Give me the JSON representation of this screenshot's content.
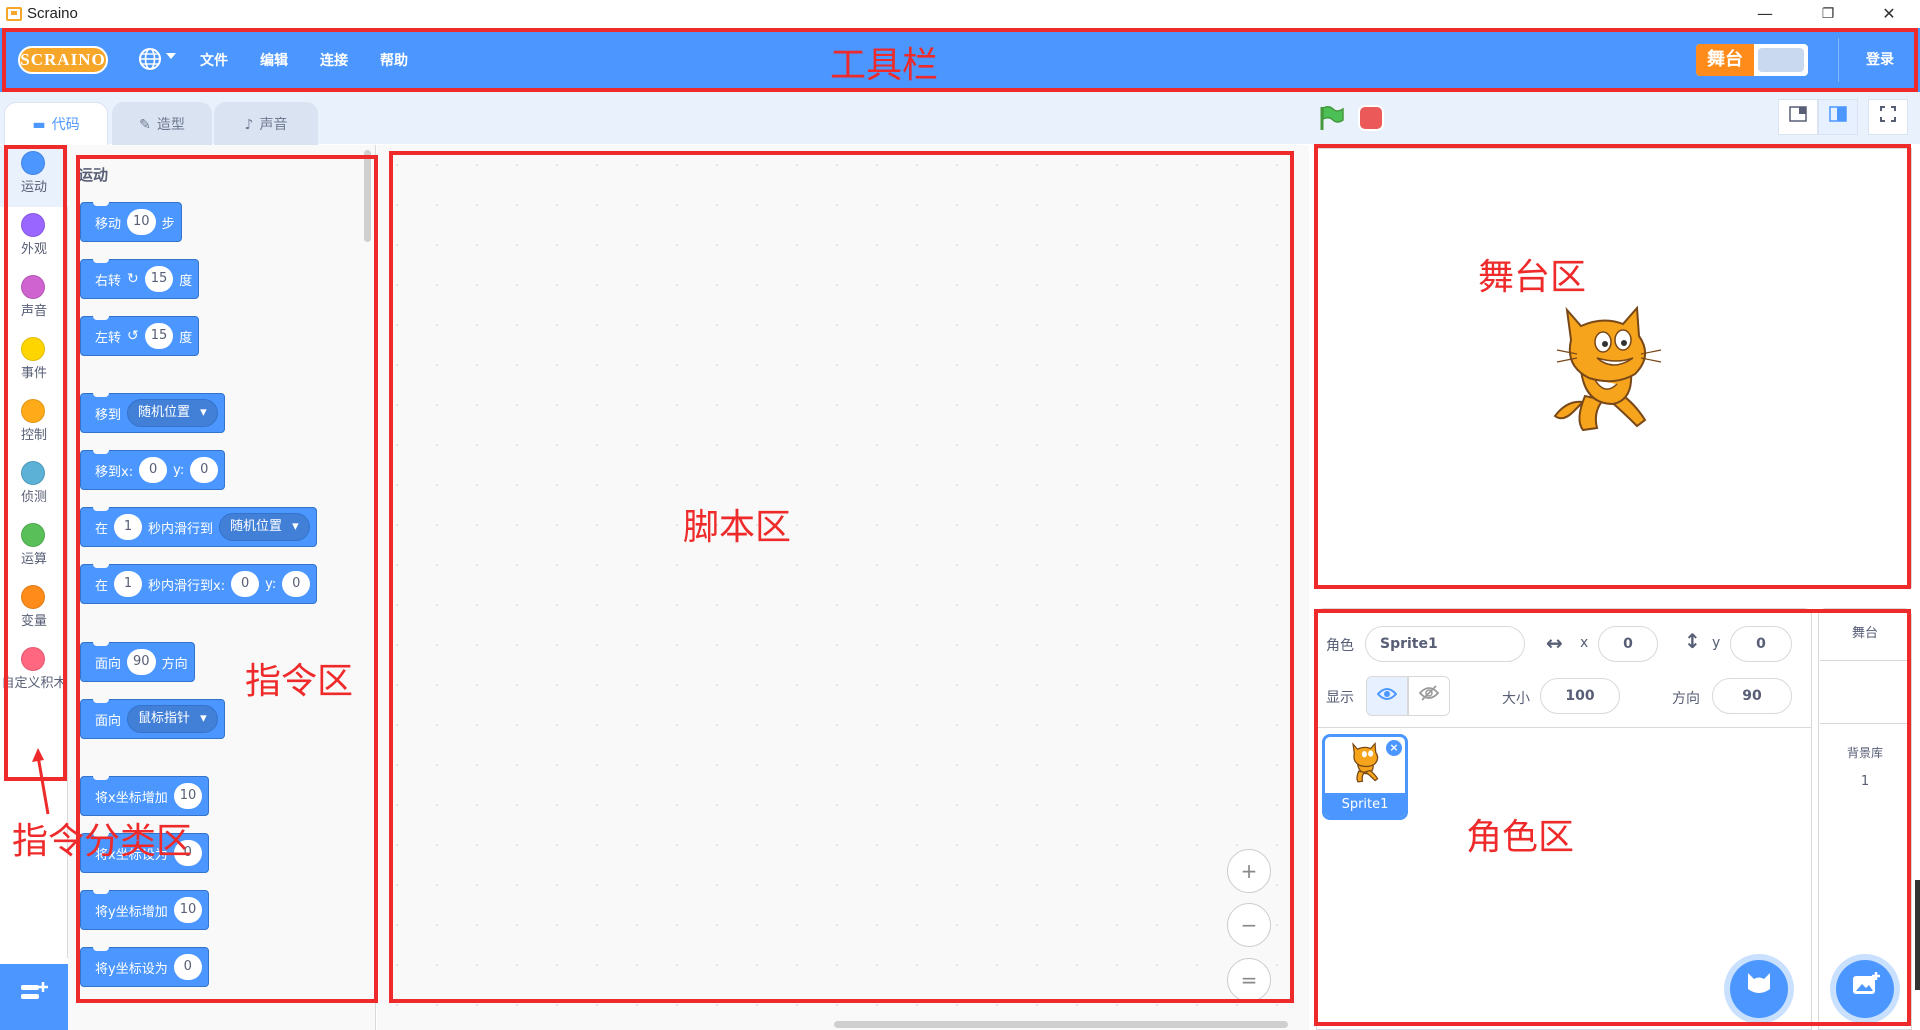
{
  "window": {
    "title": "Scraino",
    "minimize": "—",
    "maximize": "❐",
    "close": "✕"
  },
  "menubar": {
    "logo": "SCRAINO",
    "items": [
      "文件",
      "编辑",
      "连接",
      "帮助"
    ],
    "stage_toggle": "舞台",
    "login": "登录",
    "color": "#4c97ff"
  },
  "tabs": [
    {
      "label": "代码",
      "icon": "code-icon"
    },
    {
      "label": "造型",
      "icon": "brush-icon"
    },
    {
      "label": "声音",
      "icon": "speaker-icon"
    }
  ],
  "categories": [
    {
      "label": "运动",
      "color": "#4c97ff"
    },
    {
      "label": "外观",
      "color": "#9966ff"
    },
    {
      "label": "声音",
      "color": "#cf63cf"
    },
    {
      "label": "事件",
      "color": "#ffd500"
    },
    {
      "label": "控制",
      "color": "#ffab19"
    },
    {
      "label": "侦测",
      "color": "#5cb1d6"
    },
    {
      "label": "运算",
      "color": "#59c059"
    },
    {
      "label": "变量",
      "color": "#ff8c1a"
    },
    {
      "label": "自定义积木",
      "color": "#ff6680"
    }
  ],
  "palette": {
    "heading": "运动",
    "blocks": {
      "move": {
        "label": "移动",
        "value": "10",
        "suffix": "步"
      },
      "turn_right": {
        "label": "右转",
        "value": "15",
        "suffix": "度"
      },
      "turn_left": {
        "label": "左转",
        "value": "15",
        "suffix": "度"
      },
      "goto": {
        "label": "移到",
        "dropdown": "随机位置"
      },
      "goto_xy": {
        "label": "移到x:",
        "x": "0",
        "ylabel": "y:",
        "y": "0"
      },
      "glide": {
        "label": "在",
        "secs": "1",
        "mid": "秒内滑行到",
        "dropdown": "随机位置"
      },
      "glide_xy": {
        "label": "在",
        "secs": "1",
        "mid": "秒内滑行到x:",
        "x": "0",
        "ylabel": "y:",
        "y": "0"
      },
      "point_dir": {
        "label": "面向",
        "value": "90",
        "suffix": "方向"
      },
      "point_towards": {
        "label": "面向",
        "dropdown": "鼠标指针"
      },
      "change_x": {
        "label": "将x坐标增加",
        "value": "10"
      },
      "set_x": {
        "label": "将x坐标设为",
        "value": "0"
      },
      "change_y": {
        "label": "将y坐标增加",
        "value": "10"
      },
      "set_y": {
        "label": "将y坐标设为",
        "value": "0"
      }
    }
  },
  "zoom": {
    "in": "+",
    "out": "−",
    "reset": "="
  },
  "sprite_info": {
    "sprite_label": "角色",
    "sprite_name": "Sprite1",
    "x_label": "x",
    "x": "0",
    "y_label": "y",
    "y": "0",
    "show_label": "显示",
    "size_label": "大小",
    "size": "100",
    "direction_label": "方向",
    "direction": "90"
  },
  "sprites": [
    {
      "name": "Sprite1"
    }
  ],
  "stage_target": {
    "title": "舞台",
    "backdrop_label": "背景库",
    "backdrop_count": "1"
  },
  "annotations": {
    "toolbar": "工具栏",
    "stage": "舞台区",
    "script": "脚本区",
    "blocks": "指令区",
    "categories": "指令分类区",
    "sprites": "角色区",
    "color": "#ee2a2a"
  }
}
